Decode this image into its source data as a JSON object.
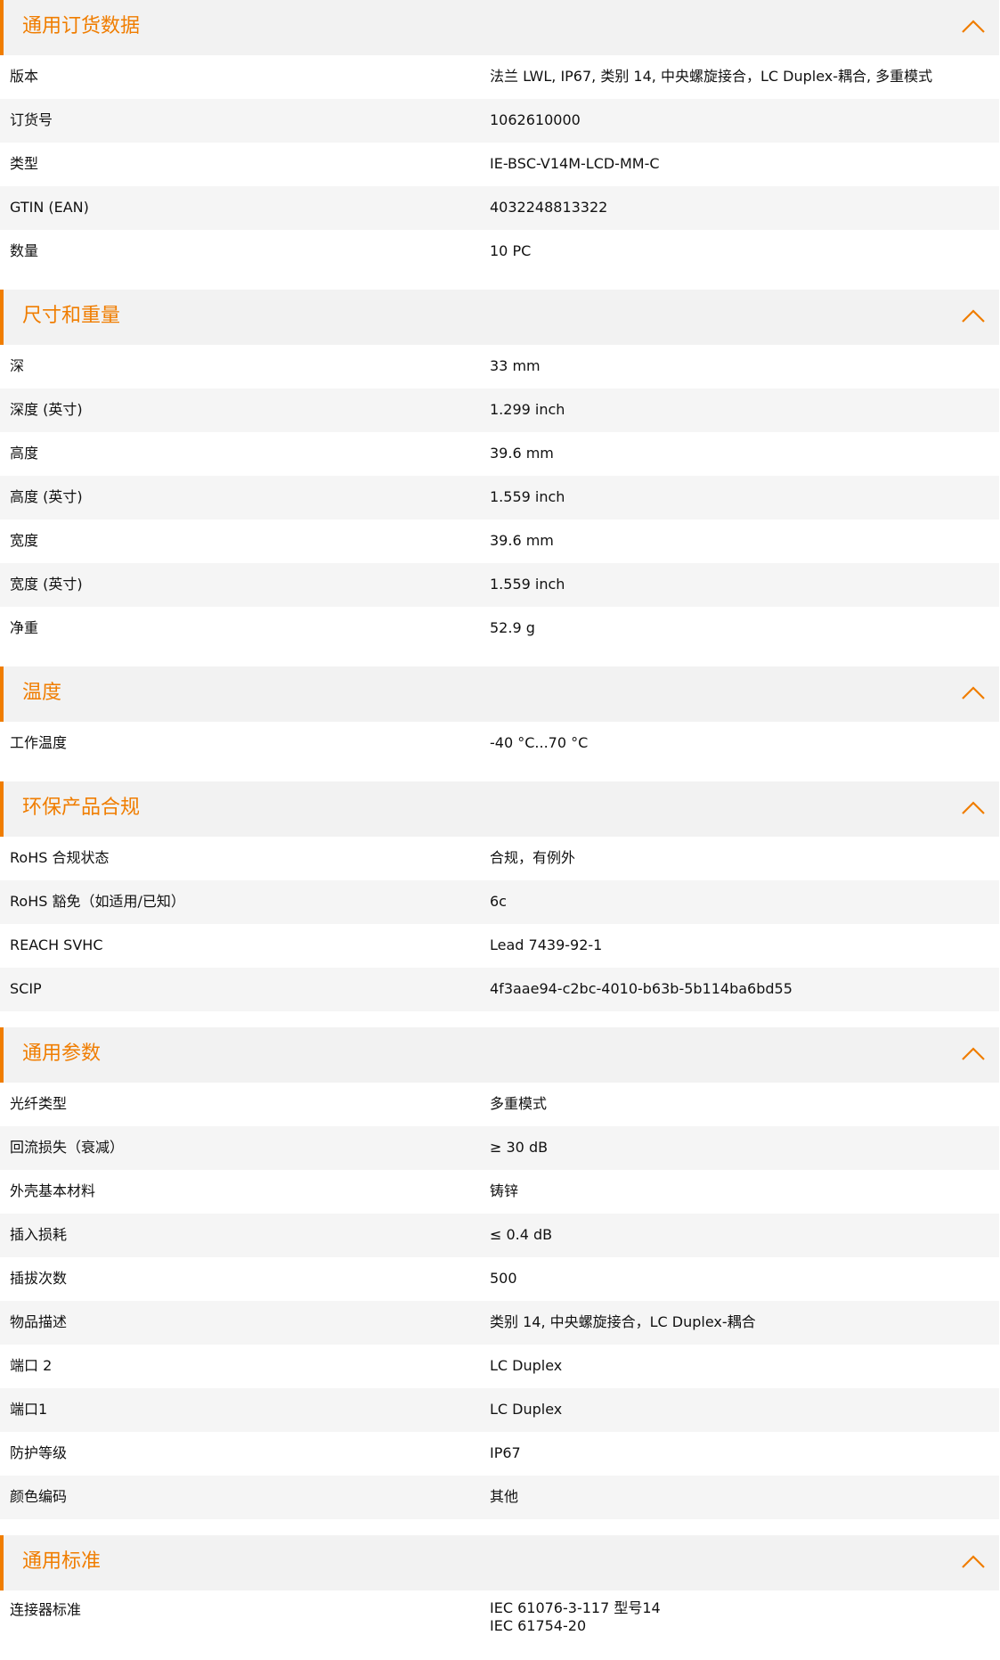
{
  "accent_color": "#f07d00",
  "sections": [
    {
      "title": "通用订货数据",
      "rows": [
        {
          "label": "版本",
          "value": "法兰 LWL, IP67, 类别 14, 中央螺旋接合，LC Duplex-耦合, 多重模式"
        },
        {
          "label": "订货号",
          "value": "1062610000"
        },
        {
          "label": "类型",
          "value": "IE-BSC-V14M-LCD-MM-C"
        },
        {
          "label": "GTIN (EAN)",
          "value": "4032248813322"
        },
        {
          "label": "数量",
          "value": "10  PC"
        }
      ]
    },
    {
      "title": "尺寸和重量",
      "rows": [
        {
          "label": "深",
          "value": "33  mm"
        },
        {
          "label": "深度 (英寸)",
          "value": "1.299  inch"
        },
        {
          "label": "高度",
          "value": "39.6  mm"
        },
        {
          "label": "高度 (英寸)",
          "value": "1.559  inch"
        },
        {
          "label": "宽度",
          "value": "39.6  mm"
        },
        {
          "label": "宽度 (英寸)",
          "value": "1.559  inch"
        },
        {
          "label": "净重",
          "value": "52.9  g"
        }
      ]
    },
    {
      "title": "温度",
      "rows": [
        {
          "label": "工作温度",
          "value": "-40 °C...70 °C"
        }
      ]
    },
    {
      "title": "环保产品合规",
      "rows": [
        {
          "label": "RoHS 合规状态",
          "value": "合规，有例外"
        },
        {
          "label": "RoHS 豁免（如适用/已知）",
          "value": "6c"
        },
        {
          "label": "REACH SVHC",
          "value": "Lead 7439-92-1"
        },
        {
          "label": "SCIP",
          "value": "4f3aae94-c2bc-4010-b63b-5b114ba6bd55"
        }
      ]
    },
    {
      "title": "通用参数",
      "rows": [
        {
          "label": "光纤类型",
          "value": "多重模式"
        },
        {
          "label": "回流损失（衰减）",
          "value": "≥ 30 dB"
        },
        {
          "label": "外壳基本材料",
          "value": "铸锌"
        },
        {
          "label": "插入损耗",
          "value": "≤ 0.4 dB"
        },
        {
          "label": "插拔次数",
          "value": "500"
        },
        {
          "label": "物品描述",
          "value": "类别 14, 中央螺旋接合，LC Duplex-耦合"
        },
        {
          "label": "端口 2",
          "value": "LC Duplex"
        },
        {
          "label": "端口1",
          "value": "LC Duplex"
        },
        {
          "label": "防护等级",
          "value": "IP67"
        },
        {
          "label": "颜色编码",
          "value": "其他"
        }
      ]
    },
    {
      "title": "通用标准",
      "rows": [
        {
          "label": "连接器标准",
          "value": "IEC 61076-3-117 型号14",
          "value2": "IEC 61754-20"
        }
      ]
    }
  ]
}
